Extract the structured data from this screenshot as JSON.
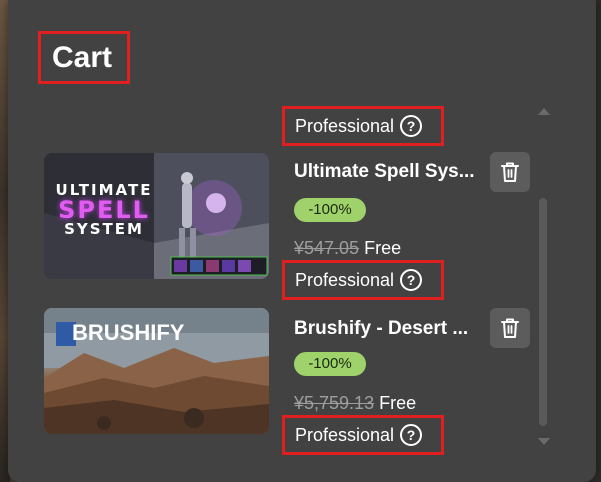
{
  "header": {
    "title": "Cart"
  },
  "items": [
    {
      "name": "",
      "discount": "",
      "price_old": "",
      "price_new": "",
      "license": "Professional",
      "thumb_text": ""
    },
    {
      "name": "Ultimate Spell Sys...",
      "discount": "-100%",
      "price_old": "¥547.05",
      "price_new": "Free",
      "license": "Professional",
      "thumb_text": [
        "ULTIMATE",
        "SPELL",
        "SYSTEM"
      ]
    },
    {
      "name": "Brushify - Desert ...",
      "discount": "-100%",
      "price_old": "¥5,759.13",
      "price_new": "Free",
      "license": "Professional",
      "thumb_text": "BRUSHIFY"
    }
  ],
  "icons": {
    "help": "question-circle-icon",
    "delete": "trash-icon"
  },
  "colors": {
    "panel_bg": "#424242",
    "discount_badge": "#9fd26a",
    "highlight_border": "#e02020"
  }
}
